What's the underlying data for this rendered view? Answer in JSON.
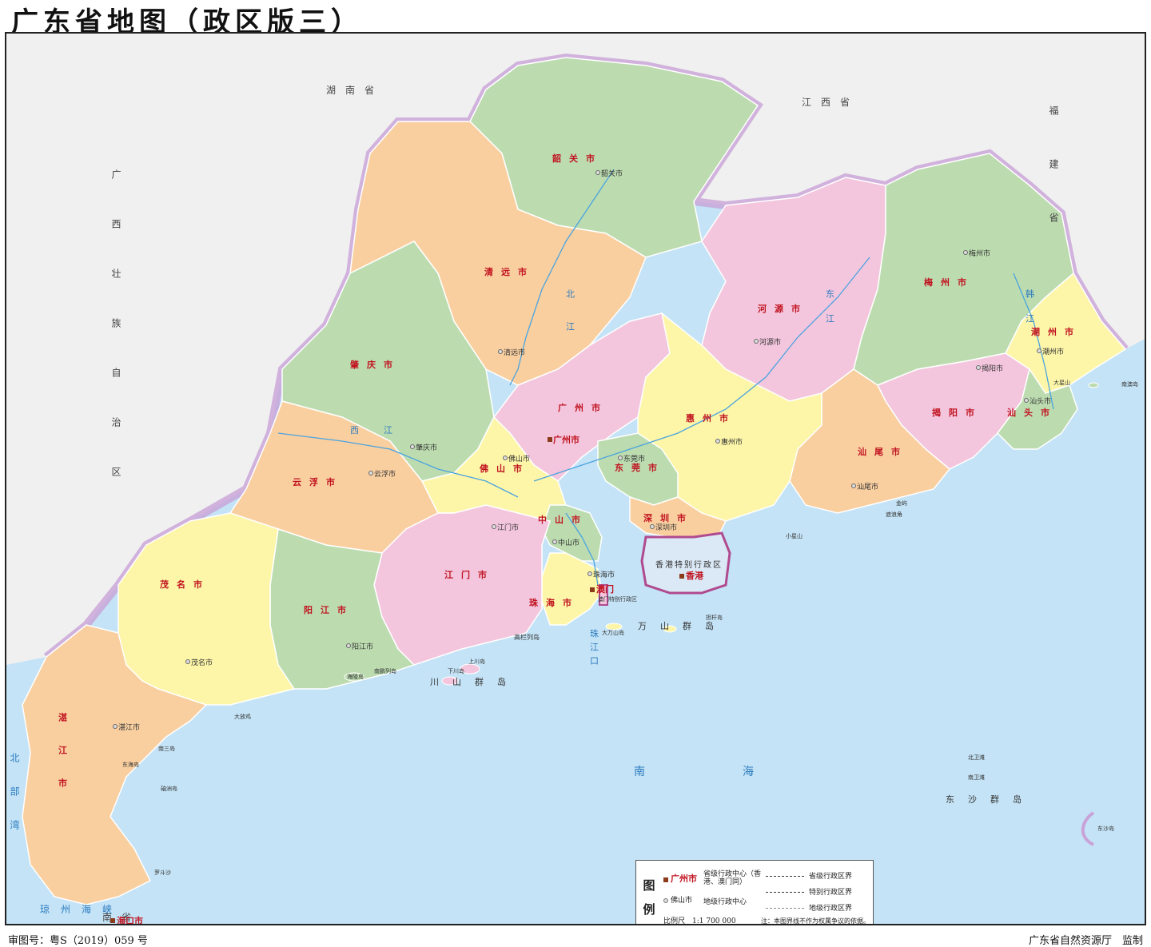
{
  "title": "广东省地图（政区版三）",
  "colors": {
    "sea": "#c4e3f6",
    "outside": "#f0f0f0",
    "green": "#bcdcb0",
    "orange": "#f9cfa0",
    "pink": "#f3c6dd",
    "yellow": "#fdf6a8",
    "province_border_glow": "#c9a2d8",
    "river": "#4aa3df",
    "region_label": "#c1121f",
    "capital": "#8b3a1a"
  },
  "neighbors": [
    {
      "name": "湖　南　省"
    },
    {
      "name": "江　西　省"
    },
    {
      "name": "福建省"
    },
    {
      "name": "广西壮族自治区"
    },
    {
      "name": "南　省"
    }
  ],
  "cities": [
    {
      "name": "韶关市",
      "seat": "韶关市",
      "color": "green"
    },
    {
      "name": "清远市",
      "seat": "清远市",
      "color": "orange"
    },
    {
      "name": "肇庆市",
      "seat": "肇庆市",
      "color": "green"
    },
    {
      "name": "云浮市",
      "seat": "云浮市",
      "color": "orange"
    },
    {
      "name": "广州市",
      "seat": "广州市",
      "color": "pink"
    },
    {
      "name": "佛山市",
      "seat": "佛山市",
      "color": "yellow"
    },
    {
      "name": "河源市",
      "seat": "河源市",
      "color": "pink"
    },
    {
      "name": "梅州市",
      "seat": "梅州市",
      "color": "green"
    },
    {
      "name": "潮州市",
      "seat": "潮州市",
      "color": "yellow"
    },
    {
      "name": "揭阳市",
      "seat": "揭阳市",
      "color": "pink"
    },
    {
      "name": "汕头市",
      "seat": "汕头市",
      "color": "green"
    },
    {
      "name": "汕尾市",
      "seat": "汕尾市",
      "color": "orange"
    },
    {
      "name": "惠州市",
      "seat": "惠州市",
      "color": "yellow"
    },
    {
      "name": "东莞市",
      "seat": "东莞市",
      "color": "green"
    },
    {
      "name": "深圳市",
      "seat": "深圳市",
      "color": "orange"
    },
    {
      "name": "中山市",
      "seat": "中山市",
      "color": "green"
    },
    {
      "name": "江门市",
      "seat": "江门市",
      "color": "pink"
    },
    {
      "name": "珠海市",
      "seat": "珠海市",
      "color": "yellow"
    },
    {
      "name": "阳江市",
      "seat": "阳江市",
      "color": "green"
    },
    {
      "name": "茂名市",
      "seat": "茂名市",
      "color": "yellow"
    },
    {
      "name": "湛江市",
      "seat": "湛江市",
      "color": "orange"
    }
  ],
  "sar": {
    "hongkong_region": "香港特别行政区",
    "hongkong": "香港",
    "macao_region": "澳门特别行政区",
    "macao": "澳门"
  },
  "water_labels": {
    "south_sea": "南　　　海",
    "pearl_mouth": "珠江口",
    "beibu_gulf": "北部湾",
    "qiongzhou_strait": "琼州海峡",
    "west_river": "西　江",
    "north_river": "北江",
    "east_river": "东江",
    "han_river": "韩江"
  },
  "islands": [
    "万　山　群　岛",
    "川　山　群　岛",
    "东　沙　群　岛",
    "高栏列岛",
    "大万山岛",
    "担杆岛",
    "南鹏列岛",
    "东海岛",
    "南三岛",
    "上川岛",
    "下川岛",
    "海陵岛",
    "南澳岛",
    "大星山",
    "小星山",
    "硇洲岛",
    "北卫滩",
    "南卫滩",
    "东沙岛",
    "罗斗沙",
    "大放鸡",
    "金屿",
    "遮浪角"
  ],
  "other_labels": {
    "haikou": "海口市"
  },
  "legend": {
    "title": "图例",
    "provincial_center_sample": "广州市",
    "provincial_center_desc": "省级行政中心（香港、澳门同）",
    "prefecture_center_sample": "佛山市",
    "prefecture_center_desc": "地级行政中心",
    "provincial_boundary": "省级行政区界",
    "special_boundary": "特别行政区界",
    "prefecture_boundary": "地级行政区界",
    "scale": "比例尺　1:1 700 000",
    "note": "注：本图界线不作为权属争议的依据。"
  },
  "footer": {
    "review_number": "审图号：粤S（2019）059 号",
    "supervisor": "广东省自然资源厅　监制"
  }
}
